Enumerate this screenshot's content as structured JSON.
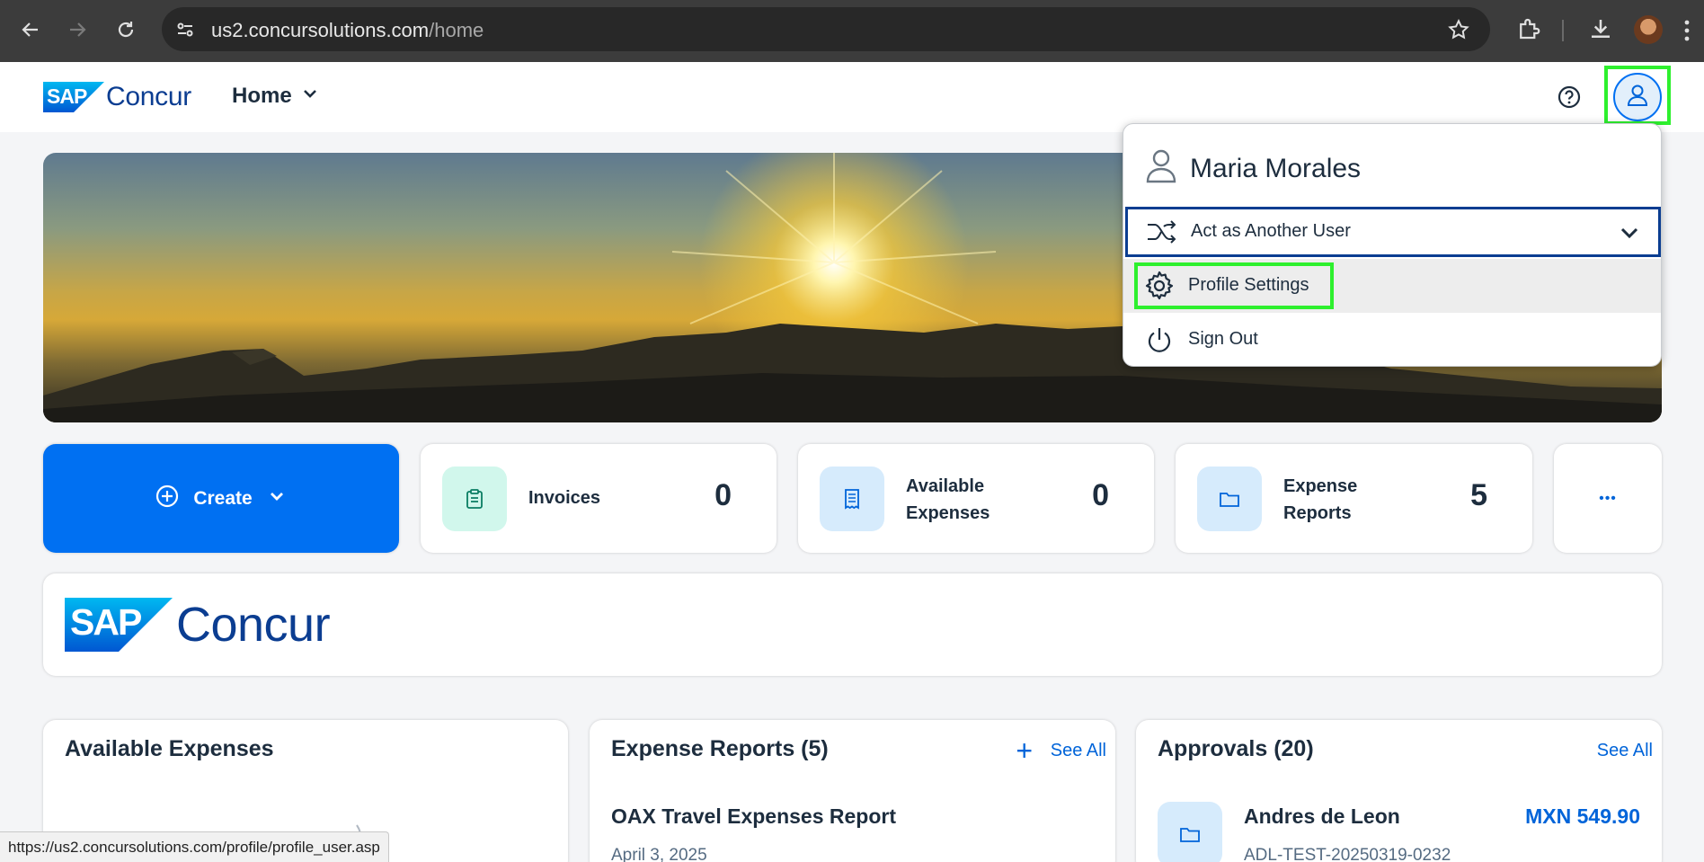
{
  "browser": {
    "url_host": "us2.concursolutions.com",
    "url_path": "/home",
    "status_url": "https://us2.concursolutions.com/profile/profile_user.asp"
  },
  "header": {
    "logo_badge": "SAP",
    "logo_text": "Concur",
    "home_label": "Home"
  },
  "user_menu": {
    "user_name": "Maria Morales",
    "items": [
      {
        "label": "Act as Another User"
      },
      {
        "label": "Profile Settings"
      },
      {
        "label": "Sign Out"
      }
    ]
  },
  "tiles": {
    "create_label": "Create",
    "invoices": {
      "label": "Invoices",
      "count": "0"
    },
    "available_expenses": {
      "label_line1": "Available",
      "label_line2": "Expenses",
      "count": "0"
    },
    "expense_reports": {
      "label_line1": "Expense",
      "label_line2": "Reports",
      "count": "5"
    },
    "more": "•••"
  },
  "banner": {
    "logo_badge": "SAP",
    "logo_text": "Concur"
  },
  "cards": {
    "available_expenses": {
      "title": "Available Expenses"
    },
    "expense_reports": {
      "title": "Expense Reports (5)",
      "see_all": "See All",
      "item_title": "OAX Travel Expenses Report",
      "item_sub": "April 3, 2025"
    },
    "approvals": {
      "title": "Approvals (20)",
      "see_all": "See All",
      "item_title": "Andres de Leon",
      "item_amount": "MXN 549.90",
      "item_sub": "ADL-TEST-20250319-0232"
    }
  },
  "colors": {
    "accent": "#0070f2",
    "brand_dark": "#0b3d91",
    "highlight": "#2ef02e"
  }
}
